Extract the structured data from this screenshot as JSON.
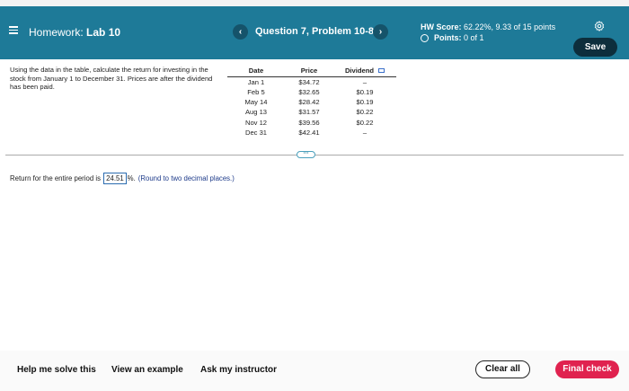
{
  "header": {
    "menu_icon": "hamburger-menu-icon",
    "hw_prefix": "Homework:",
    "hw_name": "Lab 10",
    "question_label": "Question 7, Problem 10-8",
    "prev_glyph": "‹",
    "next_glyph": "›",
    "score_label": "HW Score:",
    "score_value": "62.22%, 9.33 of 15 points",
    "points_label": "Points:",
    "points_value": "0 of 1",
    "settings_icon": "gear-icon",
    "save_label": "Save"
  },
  "question": {
    "prompt": "Using the data in the table, calculate the return for investing in the stock from January 1 to December 31. Prices are after the dividend has been paid.",
    "table": {
      "headers": [
        "Date",
        "Price",
        "Dividend"
      ],
      "rows": [
        [
          "Jan 1",
          "$34.72",
          "–"
        ],
        [
          "Feb 5",
          "$32.65",
          "$0.19"
        ],
        [
          "May 14",
          "$28.42",
          "$0.19"
        ],
        [
          "Aug 13",
          "$31.57",
          "$0.22"
        ],
        [
          "Nov 12",
          "$39.56",
          "$0.22"
        ],
        [
          "Dec 31",
          "$42.41",
          "–"
        ]
      ]
    },
    "more_glyph": "⋯",
    "answer_prefix": "Return for the entire period is",
    "answer_value": "24.51",
    "answer_suffix": "%.",
    "answer_hint": "(Round to two decimal places.)"
  },
  "footer": {
    "help_label": "Help me solve this",
    "example_label": "View an example",
    "instructor_label": "Ask my instructor",
    "clear_label": "Clear all",
    "final_label": "Final check"
  },
  "colors": {
    "header_bg": "#1e7a98",
    "save_bg": "#0d2e3c",
    "final_check_bg": "#e0224f"
  }
}
